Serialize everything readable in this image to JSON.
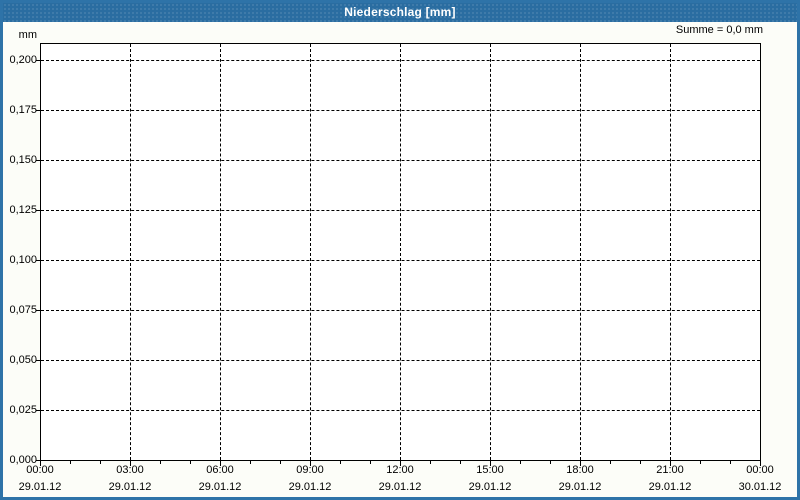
{
  "title_bar": {
    "title": "Niederschlag [mm]"
  },
  "summary_label": "Summe = 0,0 mm",
  "colors": {
    "titlebar_blue": "#2a6da1",
    "frame_border_blue": "#2e73a8",
    "plot_background": "#ffffff",
    "grid_color": "#000000",
    "title_text": "#ffffff"
  },
  "chart_data": {
    "type": "bar",
    "title": "Niederschlag [mm]",
    "ylabel": "mm",
    "ylim": [
      0,
      0.2
    ],
    "ytick_values": [
      0.2,
      0.175,
      0.15,
      0.125,
      0.1,
      0.075,
      0.05,
      0.025,
      0.0
    ],
    "ytick_labels": [
      "0,200",
      "0,175",
      "0,150",
      "0,125",
      "0,100",
      "0,075",
      "0,050",
      "0,025",
      "0,000"
    ],
    "xtick_times": [
      "00:00",
      "03:00",
      "06:00",
      "09:00",
      "12:00",
      "15:00",
      "18:00",
      "21:00",
      "00:00"
    ],
    "xtick_dates": [
      "29.01.12",
      "29.01.12",
      "29.01.12",
      "29.01.12",
      "29.01.12",
      "29.01.12",
      "29.01.12",
      "29.01.12",
      "30.01.12"
    ],
    "x_major_interval_hours": 3,
    "x_minor_interval_hours": 1,
    "grid": true,
    "legend_position": "none",
    "series": [
      {
        "name": "Niederschlag",
        "values": [],
        "sum": "0,0 mm"
      }
    ],
    "annotation": "Summe = 0,0 mm"
  }
}
